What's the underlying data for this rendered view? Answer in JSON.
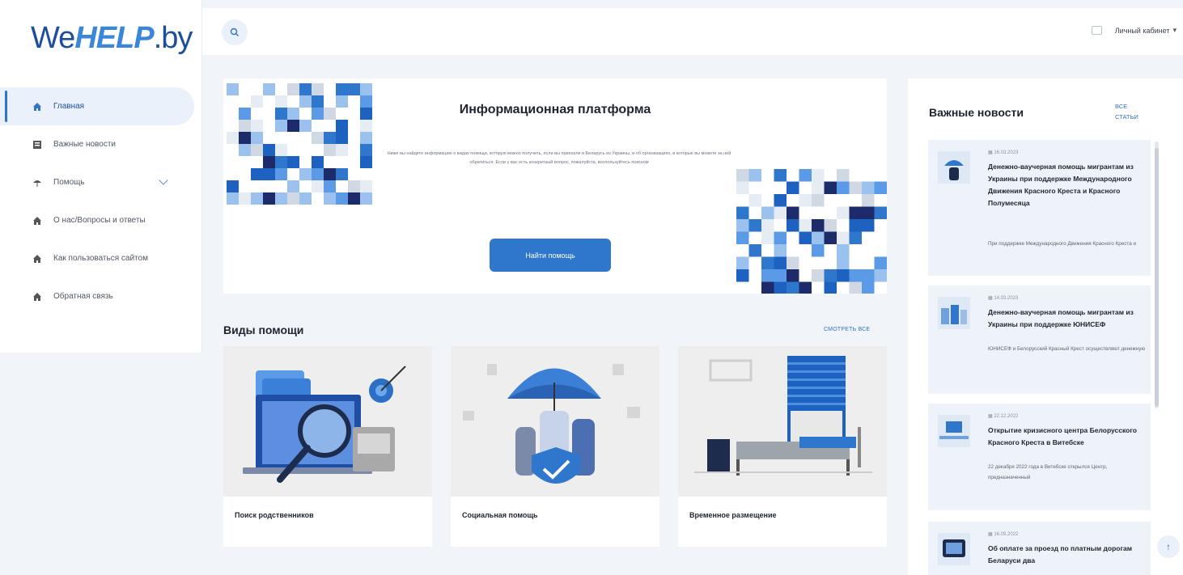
{
  "logo": {
    "we": "We",
    "help": "HELP",
    "by": ".by"
  },
  "header": {
    "account_label": "Личный кабинет",
    "caret": "▾"
  },
  "sidebar": {
    "items": [
      {
        "label": "Главная",
        "icon": "home-icon"
      },
      {
        "label": "Важные новости",
        "icon": "news-icon"
      },
      {
        "label": "Помощь",
        "icon": "umbrella-icon"
      },
      {
        "label": "О нас/Вопросы и ответы",
        "icon": "home-icon"
      },
      {
        "label": "Как пользоваться сайтом",
        "icon": "home-icon"
      },
      {
        "label": "Обратная связь",
        "icon": "home-icon"
      }
    ]
  },
  "hero": {
    "title": "Информационная платформа",
    "text": "Ниже вы найдете информацию о видах помощи, которую можно получить, если вы приехали в Беларусь из Украины, и об организациях, в которые вы можете за ней обратиться. Если у вас есть конкретный вопрос, пожалуйста, воспользуйтесь поиском",
    "button": "Найти помощь"
  },
  "types": {
    "title": "Виды помощи",
    "link": "СМОТРЕТЬ ВСЕ",
    "cards": [
      {
        "label": "Поиск родственников"
      },
      {
        "label": "Социальная помощь"
      },
      {
        "label": "Временное размещение"
      }
    ]
  },
  "news": {
    "title": "Важные новости",
    "all_link": "ВСЕ СТАТЬИ",
    "items": [
      {
        "date": "16.03.2023",
        "head": "Денежно-ваучерная помощь мигрантам из Украины при поддержке Международного Движения Красного Креста и Красного Полумесяца",
        "excerpt": "При поддержке Международного Движения Красного Креста и"
      },
      {
        "date": "14.03.2023",
        "head": "Денежно-ваучерная помощь мигрантам из Украины при поддержке ЮНИСЕФ",
        "excerpt": "ЮНИСЕФ и Белорусский Красный Крест осуществляют денежную"
      },
      {
        "date": "22.12.2022",
        "head": "Открытие кризисного центра Белорусского Красного Креста в Витебске",
        "excerpt": "22 декабря 2022 года в Витебске открылся Центр, предназначенный"
      },
      {
        "date": "16.09.2022",
        "head": "Об оплате за проезд по платным дорогам Беларуси два",
        "excerpt": ""
      }
    ]
  },
  "colors": {
    "accent": "#2f77cc",
    "brand": "#1d4e9e",
    "light": "#eaf1fb"
  }
}
